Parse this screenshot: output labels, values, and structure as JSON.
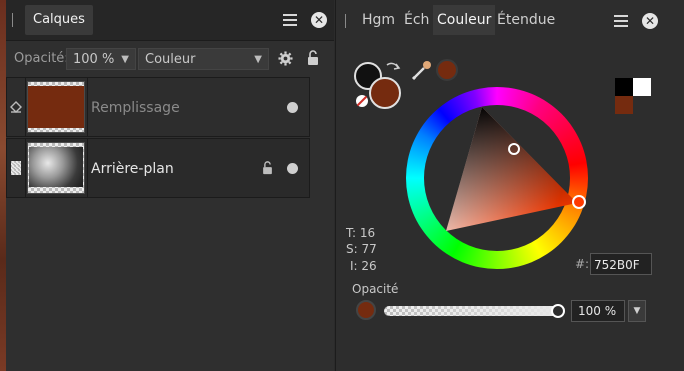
{
  "layers_panel": {
    "tab_label": "Calques",
    "opacity_label": "Opacité:",
    "opacity_value": "100 %",
    "blend_mode": "Couleur",
    "layers": [
      {
        "name": "Remplissage",
        "fill": "#752B0F"
      },
      {
        "name": "Arrière-plan"
      }
    ]
  },
  "color_panel": {
    "tabs": [
      "Hgm",
      "Éch",
      "Couleur",
      "Étendue"
    ],
    "active_tab": "Couleur",
    "primary_color": "#111111",
    "secondary_color": "#752B0F",
    "picked_color": "#752B0F",
    "readout": {
      "t": "T: 16",
      "s": "S: 77",
      "i": "I: 26"
    },
    "hex_label": "#:",
    "hex_value": "752B0F",
    "opacity_label": "Opacité",
    "opacity_value": "100 %",
    "opacity_level": 1.0,
    "swatches": [
      "#000000",
      "#ffffff",
      "#752B0F"
    ]
  },
  "icons": [
    "grip-icon",
    "menu-icon",
    "close-icon",
    "gear-icon",
    "lock-icon",
    "fill-layer-icon",
    "pixel-layer-icon",
    "eyedropper-icon",
    "swap-colors-icon",
    "no-color-icon",
    "chevron-down-icon"
  ]
}
